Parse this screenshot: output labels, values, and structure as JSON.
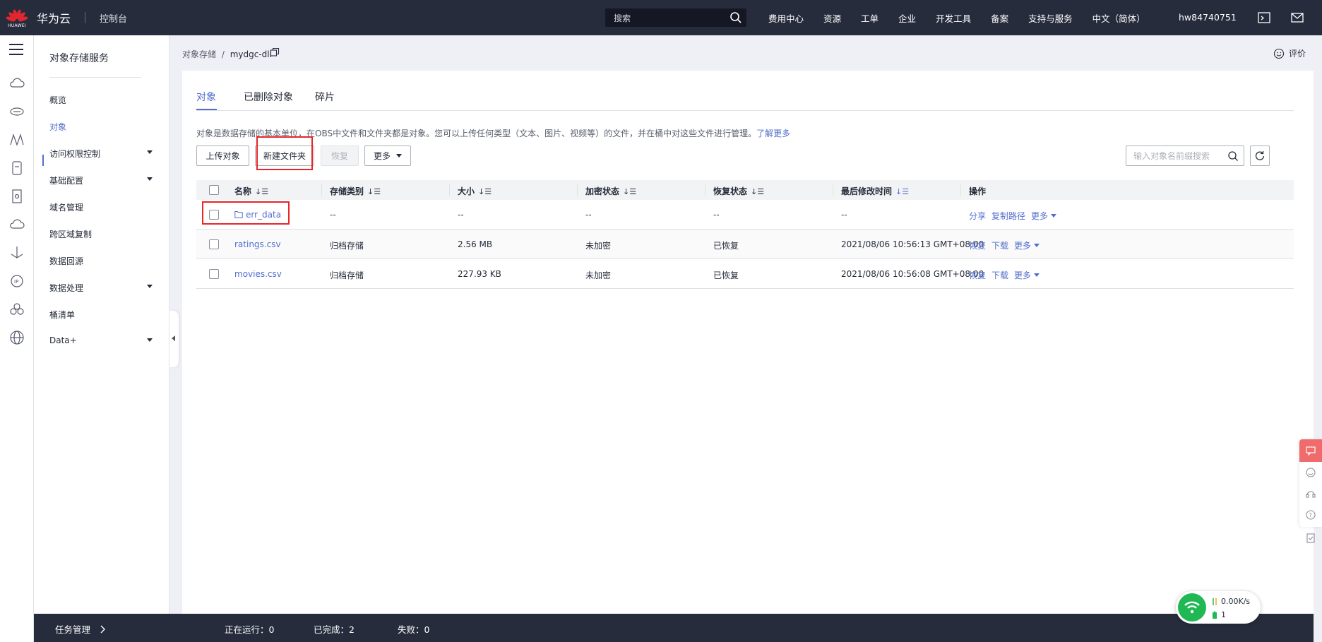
{
  "topbar": {
    "logo_text": "HUAWEI",
    "brand": "华为云",
    "console": "控制台",
    "search_placeholder": "搜索",
    "links": [
      "费用中心",
      "资源",
      "工单",
      "企业",
      "开发工具",
      "备案",
      "支持与服务",
      "中文（简体）"
    ],
    "user": "hw84740751"
  },
  "sidebar": {
    "title": "对象存储服务",
    "items": [
      {
        "label": "概览",
        "expandable": false,
        "active": false
      },
      {
        "label": "对象",
        "expandable": false,
        "active": true
      },
      {
        "label": "访问权限控制",
        "expandable": true,
        "active": false
      },
      {
        "label": "基础配置",
        "expandable": true,
        "active": false
      },
      {
        "label": "域名管理",
        "expandable": false,
        "active": false
      },
      {
        "label": "跨区域复制",
        "expandable": false,
        "active": false
      },
      {
        "label": "数据回源",
        "expandable": false,
        "active": false
      },
      {
        "label": "数据处理",
        "expandable": true,
        "active": false
      },
      {
        "label": "桶清单",
        "expandable": false,
        "active": false
      },
      {
        "label": "Data+",
        "expandable": true,
        "active": false
      }
    ]
  },
  "breadcrumb": {
    "parent": "对象存储",
    "separator": "/",
    "current": "mydgc-dli"
  },
  "rate_label": "评价",
  "tabs": [
    "对象",
    "已删除对象",
    "碎片"
  ],
  "description": "对象是数据存储的基本单位，在OBS中文件和文件夹都是对象。您可以上传任何类型（文本、图片、视频等）的文件，并在桶中对这些文件进行管理。",
  "learn_more": "了解更多",
  "toolbar": {
    "upload": "上传对象",
    "new_folder": "新建文件夹",
    "restore": "恢复",
    "more": "更多",
    "search_placeholder": "输入对象名前缀搜索"
  },
  "table": {
    "headers": [
      "名称",
      "存储类别",
      "大小",
      "加密状态",
      "恢复状态",
      "最后修改时间",
      "操作"
    ],
    "rows": [
      {
        "name": "err_data",
        "is_folder": true,
        "storage": "--",
        "size": "--",
        "encryption": "--",
        "restore": "--",
        "modified": "--",
        "ops": [
          "分享",
          "复制路径",
          "更多"
        ]
      },
      {
        "name": "ratings.csv",
        "is_folder": false,
        "storage": "归档存储",
        "size": "2.56 MB",
        "encryption": "未加密",
        "restore": "已恢复",
        "modified": "2021/08/06 10:56:13 GMT+08:00",
        "ops": [
          "恢复",
          "下载",
          "更多"
        ]
      },
      {
        "name": "movies.csv",
        "is_folder": false,
        "storage": "归档存储",
        "size": "227.93 KB",
        "encryption": "未加密",
        "restore": "已恢复",
        "modified": "2021/08/06 10:56:08 GMT+08:00",
        "ops": [
          "恢复",
          "下载",
          "更多"
        ]
      }
    ]
  },
  "taskbar": {
    "title": "任务管理",
    "running_label": "正在运行：",
    "running": "0",
    "done_label": "已完成：",
    "done": "2",
    "failed_label": "失败：",
    "failed": "0"
  },
  "network_widget": {
    "speed": "0.00K/s",
    "count": "1"
  },
  "colors": {
    "accent": "#526ecc",
    "topbar": "#272c3d",
    "highlight": "#e5262b",
    "logo": "#e0262e"
  }
}
